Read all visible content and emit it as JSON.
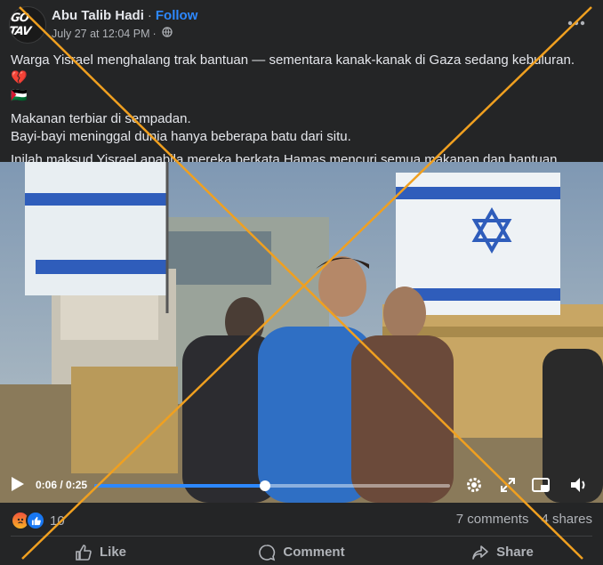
{
  "post": {
    "avatar_text": "GO TAV",
    "author": "Abu Talib Hadi",
    "separator": "·",
    "follow_label": "Follow",
    "timestamp": "July 27 at 12:04 PM",
    "meta_separator": "·",
    "visibility_icon": "globe-icon",
    "text": {
      "line1": "Warga Yisrael menghalang trak bantuan — sementara kanak-kanak di Gaza sedang kebuluran. 💔",
      "line1_flag": "🇵🇸",
      "line2": "Makanan terbiar di sempadan.",
      "line3": "Bayi-bayi meninggal dunia hanya beberapa batu dari situ.",
      "line4": "Inilah maksud Yisrael apabila mereka berkata Hamas mencuri semua makanan dan bantuan."
    }
  },
  "video": {
    "time": "0:06 / 0:25",
    "progress": 0.48,
    "icons": [
      "play-icon",
      "settings-icon",
      "fullscreen-icon",
      "miniplayer-icon",
      "volume-icon"
    ]
  },
  "stats": {
    "reaction_icons": [
      "angry-reaction-icon",
      "like-reaction-icon"
    ],
    "reaction_count": "10",
    "comments": "7 comments",
    "shares": "4 shares"
  },
  "actions": {
    "like_label": "Like",
    "comment_label": "Comment",
    "share_label": "Share"
  },
  "colors": {
    "background": "#242526",
    "accent": "#2d88ff",
    "text_primary": "#e4e6eb",
    "text_secondary": "#b0b3b8",
    "overlay_cross": "#f0a020"
  }
}
